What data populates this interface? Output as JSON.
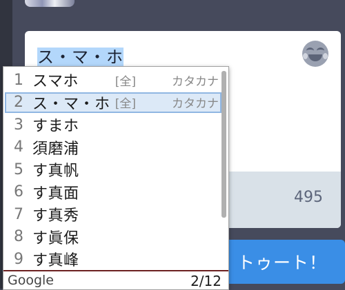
{
  "composer": {
    "text": "ス・マ・ホ",
    "char_count": "495",
    "emoji_icon": "laughing-tears-emoji-icon"
  },
  "toot_button": {
    "label": "トゥート！"
  },
  "ime": {
    "brand": "Google",
    "page": "2/12",
    "selected_index": 2,
    "candidates": [
      {
        "num": "1",
        "text": "スマホ",
        "tag": "[全]",
        "kind": "カタカナ"
      },
      {
        "num": "2",
        "text": "ス・マ・ホ",
        "tag": "[全]",
        "kind": "カタカナ"
      },
      {
        "num": "3",
        "text": "すまホ"
      },
      {
        "num": "4",
        "text": "須磨浦"
      },
      {
        "num": "5",
        "text": "す真帆"
      },
      {
        "num": "6",
        "text": "す真面"
      },
      {
        "num": "7",
        "text": "す真秀"
      },
      {
        "num": "8",
        "text": "す眞保"
      },
      {
        "num": "9",
        "text": "す真峰"
      }
    ]
  }
}
